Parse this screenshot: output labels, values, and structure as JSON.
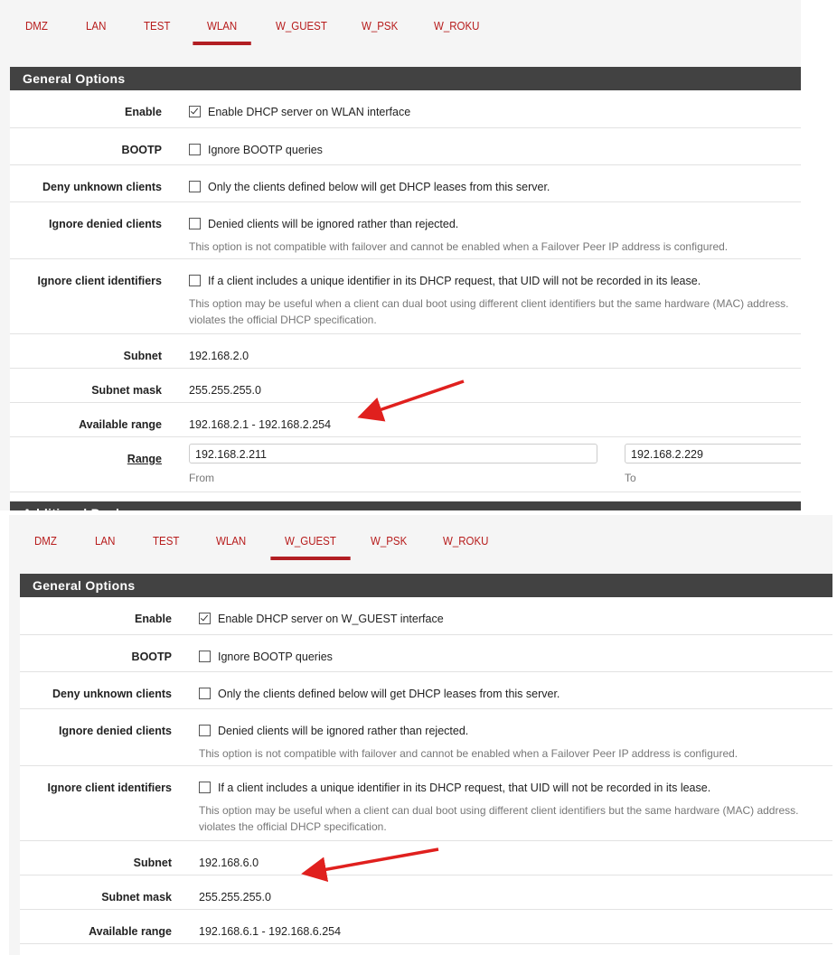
{
  "accent": "#b21e23",
  "screens": [
    {
      "tabs": [
        "DMZ",
        "LAN",
        "TEST",
        "WLAN",
        "W_GUEST",
        "W_PSK",
        "W_ROKU"
      ],
      "active_tab": "WLAN",
      "section_title": "General Options",
      "enable": {
        "label": "Enable",
        "checked": true,
        "text": "Enable DHCP server on WLAN interface"
      },
      "bootp": {
        "label": "BOOTP",
        "checked": false,
        "text": "Ignore BOOTP queries"
      },
      "deny_unknown": {
        "label": "Deny unknown clients",
        "checked": false,
        "text": "Only the clients defined below will get DHCP leases from this server."
      },
      "ignore_denied": {
        "label": "Ignore denied clients",
        "checked": false,
        "text": "Denied clients will be ignored rather than rejected.",
        "help": "This option is not compatible with failover and cannot be enabled when a Failover Peer IP address is configured."
      },
      "ignore_uid": {
        "label": "Ignore client identifiers",
        "checked": false,
        "text": "If a client includes a unique identifier in its DHCP request, that UID will not be recorded in its lease.",
        "help1": "This option may be useful when a client can dual boot using different client identifiers but the same hardware (MAC) address.",
        "help2": "violates the official DHCP specification."
      },
      "subnet": {
        "label": "Subnet",
        "value": "192.168.2.0"
      },
      "subnet_mask": {
        "label": "Subnet mask",
        "value": "255.255.255.0"
      },
      "available_range": {
        "label": "Available range",
        "value": "192.168.2.1 - 192.168.2.254"
      },
      "range": {
        "label": "Range",
        "from": "192.168.2.211",
        "from_label": "From",
        "to": "192.168.2.229",
        "to_label": "To"
      },
      "next_section_title": "Additional Pools"
    },
    {
      "tabs": [
        "DMZ",
        "LAN",
        "TEST",
        "WLAN",
        "W_GUEST",
        "W_PSK",
        "W_ROKU"
      ],
      "active_tab": "W_GUEST",
      "section_title": "General Options",
      "enable": {
        "label": "Enable",
        "checked": true,
        "text": "Enable DHCP server on W_GUEST interface"
      },
      "bootp": {
        "label": "BOOTP",
        "checked": false,
        "text": "Ignore BOOTP queries"
      },
      "deny_unknown": {
        "label": "Deny unknown clients",
        "checked": false,
        "text": "Only the clients defined below will get DHCP leases from this server."
      },
      "ignore_denied": {
        "label": "Ignore denied clients",
        "checked": false,
        "text": "Denied clients will be ignored rather than rejected.",
        "help": "This option is not compatible with failover and cannot be enabled when a Failover Peer IP address is configured."
      },
      "ignore_uid": {
        "label": "Ignore client identifiers",
        "checked": false,
        "text": "If a client includes a unique identifier in its DHCP request, that UID will not be recorded in its lease.",
        "help1": "This option may be useful when a client can dual boot using different client identifiers but the same hardware (MAC) address.",
        "help2": "violates the official DHCP specification."
      },
      "subnet": {
        "label": "Subnet",
        "value": "192.168.6.0"
      },
      "subnet_mask": {
        "label": "Subnet mask",
        "value": "255.255.255.0"
      },
      "available_range": {
        "label": "Available range",
        "value": "192.168.6.1 - 192.168.6.254"
      }
    }
  ],
  "annotation_arrow_color": "#e0201e"
}
